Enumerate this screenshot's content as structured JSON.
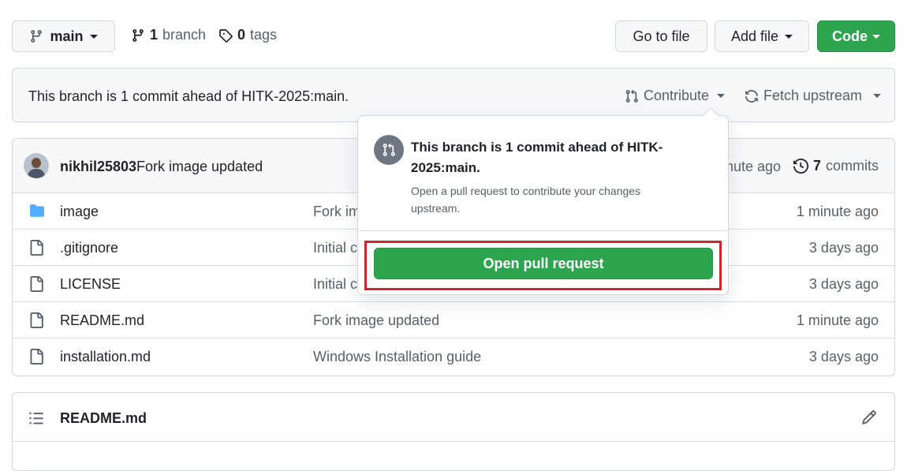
{
  "branch_bar": {
    "branch_name": "main",
    "branch_count": "1",
    "branch_label": "branch",
    "tag_count": "0",
    "tag_label": "tags",
    "go_to_file": "Go to file",
    "add_file": "Add file",
    "code": "Code"
  },
  "ahead_bar": {
    "text": "This branch is 1 commit ahead of HITK-2025:main.",
    "contribute": "Contribute",
    "fetch_upstream": "Fetch upstream"
  },
  "commit_header": {
    "author": "nikhil25803",
    "message": "Fork image updated",
    "time": "1 minute ago",
    "commit_count": "7",
    "commit_label": "commits"
  },
  "files": [
    {
      "name": "image",
      "icon": "folder-icon",
      "message": "Fork image updated",
      "time": "1 minute ago"
    },
    {
      "name": ".gitignore",
      "icon": "file-icon",
      "message": "Initial commit",
      "time": "3 days ago"
    },
    {
      "name": "LICENSE",
      "icon": "file-icon",
      "message": "Initial commit",
      "time": "3 days ago"
    },
    {
      "name": "README.md",
      "icon": "file-icon",
      "message": "Fork image updated",
      "time": "1 minute ago"
    },
    {
      "name": "installation.md",
      "icon": "file-icon",
      "message": "Windows Installation guide",
      "time": "3 days ago"
    }
  ],
  "readme": {
    "title": "README.md"
  },
  "popover": {
    "title_line1": "This branch is 1 commit ahead of HITK-",
    "title_line2": "2025:main.",
    "desc_line1": "Open a pull request to contribute your changes",
    "desc_line2": "upstream.",
    "button": "Open pull request"
  },
  "colors": {
    "green": "#2da44e",
    "highlight": "#d1242f",
    "folder": "#54aeff"
  }
}
